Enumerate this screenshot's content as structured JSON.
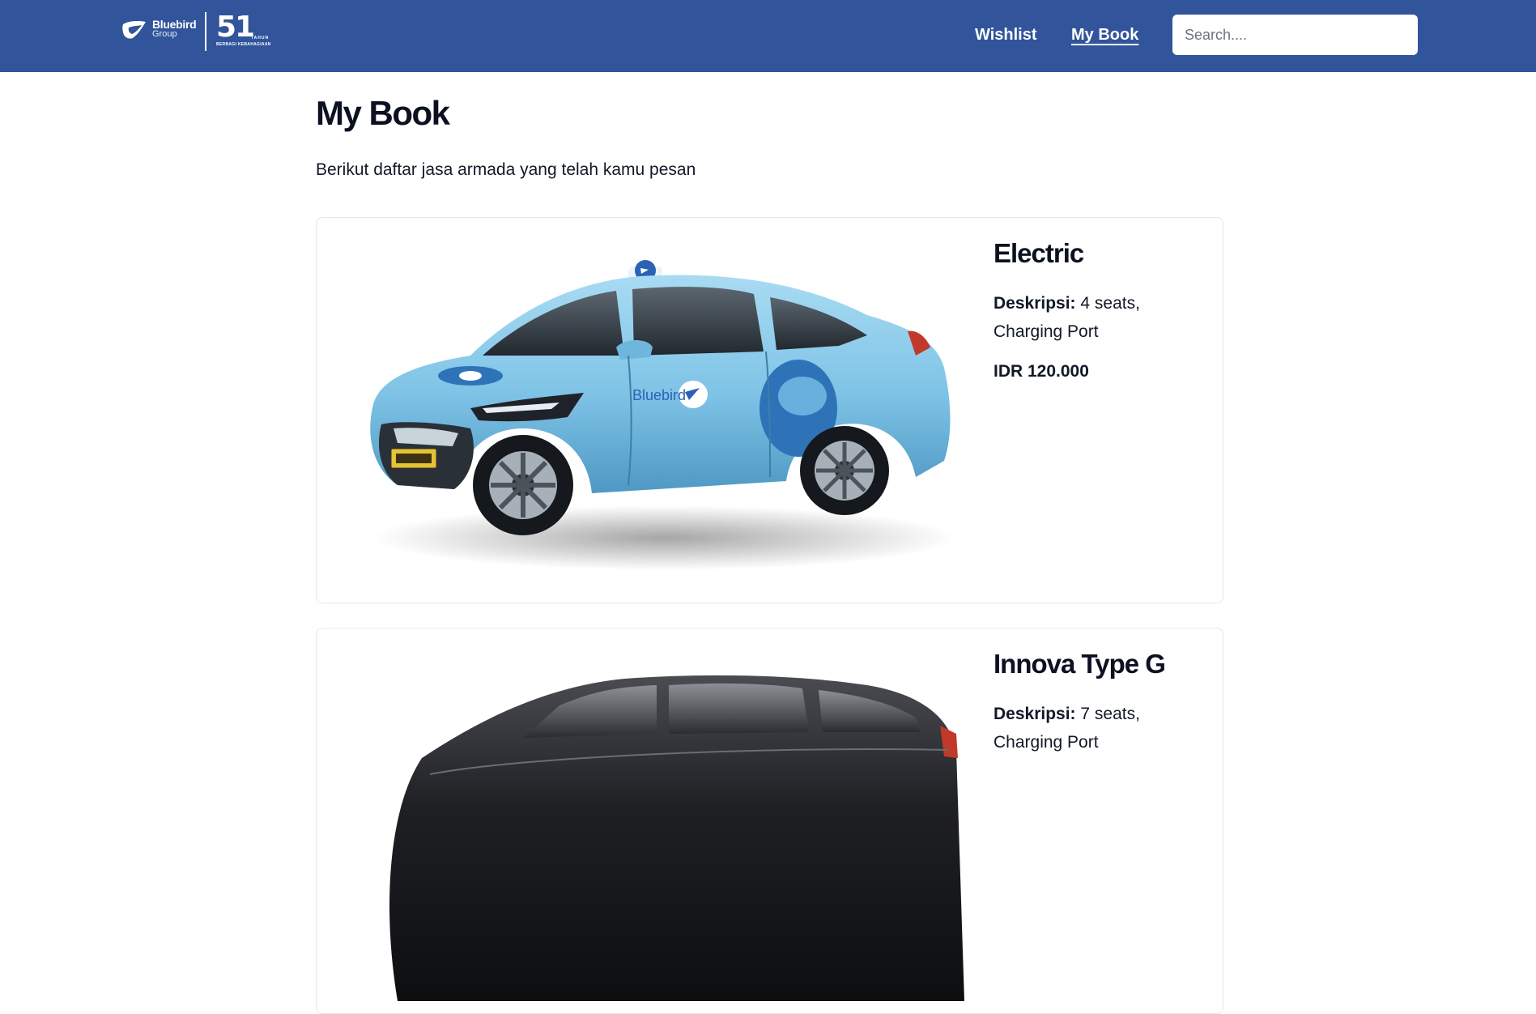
{
  "brand": {
    "name": "Bluebird",
    "sub": "Group",
    "anniversary_number": "51",
    "anniversary_unit": "TAHUN",
    "anniversary_tagline": "BERBAGI KEBAHAGIAAN"
  },
  "nav": {
    "wishlist_label": "Wishlist",
    "mybook_label": "My Book",
    "active": "My Book"
  },
  "search": {
    "placeholder": "Search....",
    "value": ""
  },
  "page": {
    "title": "My Book",
    "subtitle": "Berikut daftar jasa armada yang telah kamu pesan"
  },
  "bookings": [
    {
      "name": "Electric",
      "desc_label": "Deskripsi:",
      "desc": "4 seats, Charging Port",
      "price": "IDR 120.000",
      "image": "light-blue-electric-taxi"
    },
    {
      "name": "Innova Type G",
      "desc_label": "Deskripsi:",
      "desc": "7 seats, Charging Port",
      "price": "",
      "image": "black-mpv"
    }
  ],
  "colors": {
    "navbar": "#31549b",
    "text": "#111827",
    "card_border": "#e5e7eb",
    "taxi_body": "#7ec3e6",
    "mpv_body": "#1c1c1e"
  }
}
